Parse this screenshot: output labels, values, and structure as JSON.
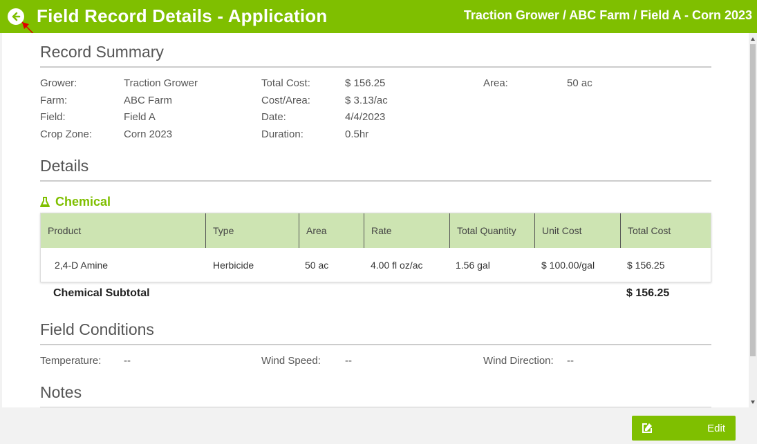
{
  "header": {
    "title": "Field Record Details - Application",
    "breadcrumb": "Traction Grower / ABC Farm / Field A - Corn 2023"
  },
  "summary": {
    "title": "Record Summary",
    "grower_label": "Grower:",
    "grower": "Traction Grower",
    "farm_label": "Farm:",
    "farm": "ABC Farm",
    "field_label": "Field:",
    "field": "Field A",
    "cropzone_label": "Crop Zone:",
    "cropzone": "Corn 2023",
    "totalcost_label": "Total Cost:",
    "totalcost": "$ 156.25",
    "costarea_label": "Cost/Area:",
    "costarea": "$ 3.13/ac",
    "date_label": "Date:",
    "date": "4/4/2023",
    "duration_label": "Duration:",
    "duration": "0.5hr",
    "area_label": "Area:",
    "area": "50 ac"
  },
  "details": {
    "title": "Details",
    "chemical_heading": "Chemical",
    "columns": [
      "Product",
      "Type",
      "Area",
      "Rate",
      "Total Quantity",
      "Unit Cost",
      "Total Cost"
    ],
    "rows": [
      [
        "2,4-D Amine",
        "Herbicide",
        "50 ac",
        "4.00 fl oz/ac",
        "1.56 gal",
        "$ 100.00/gal",
        "$ 156.25"
      ]
    ],
    "subtotal_label": "Chemical Subtotal",
    "subtotal_value": "$ 156.25"
  },
  "conditions": {
    "title": "Field Conditions",
    "temperature_label": "Temperature:",
    "temperature": "--",
    "windspeed_label": "Wind Speed:",
    "windspeed": "--",
    "winddir_label": "Wind Direction:",
    "winddir": "--"
  },
  "notes": {
    "title": "Notes"
  },
  "footer": {
    "edit_label": "Edit"
  },
  "colors": {
    "brand": "#7fbf00",
    "table_header": "#cde4b2"
  }
}
